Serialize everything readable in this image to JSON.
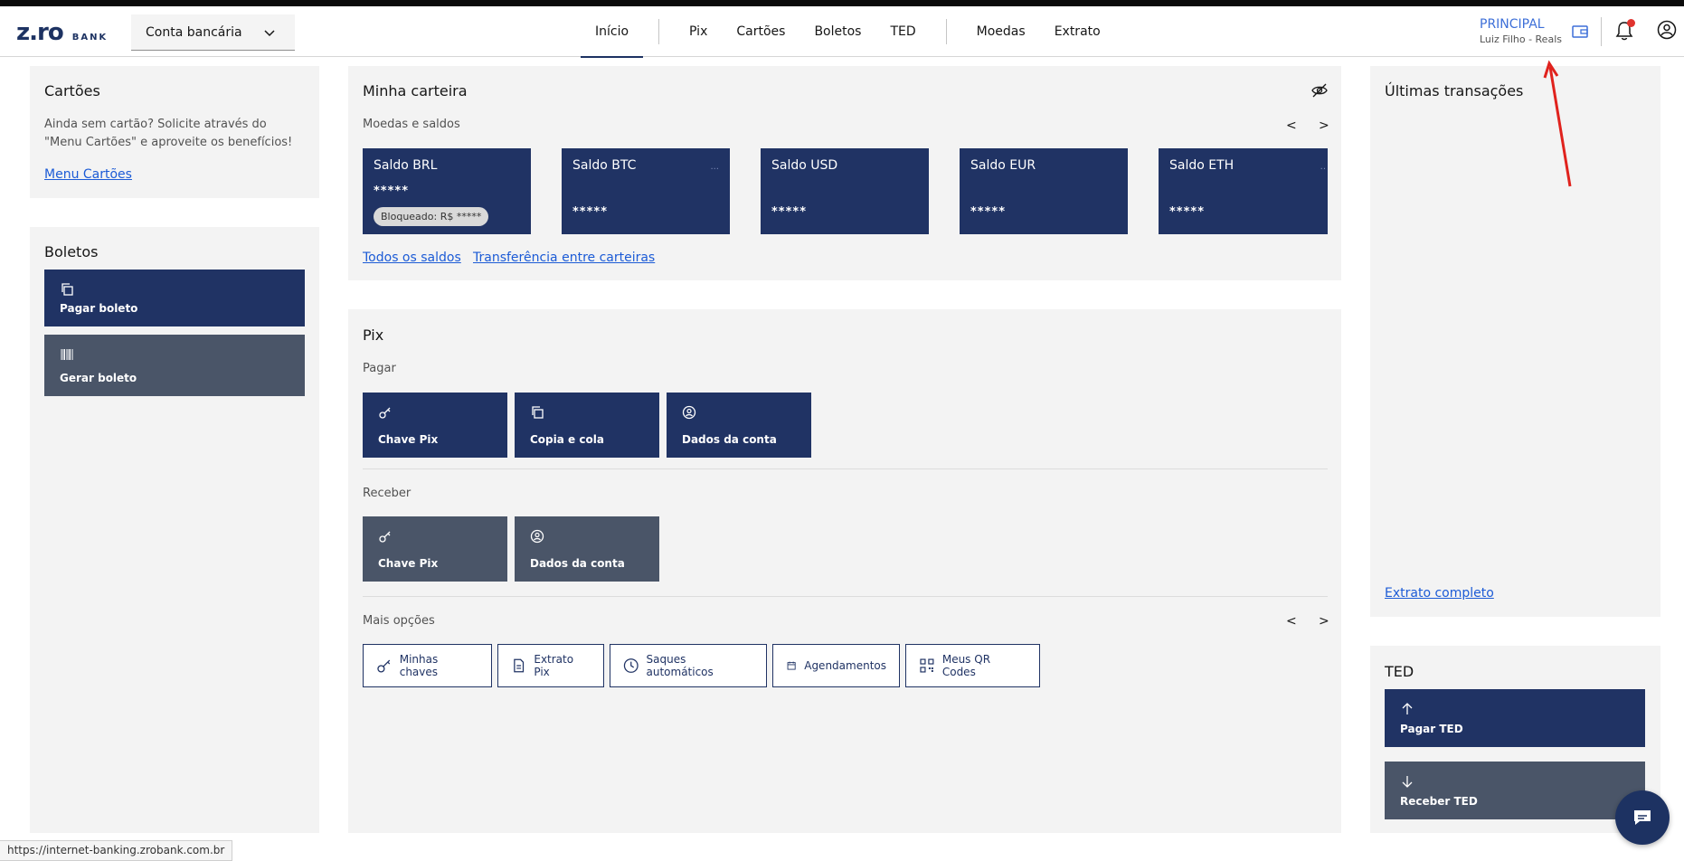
{
  "header": {
    "logo_main": "z.ro",
    "logo_bank": "BANK",
    "account_select": "Conta bancária",
    "nav": [
      "Início",
      "Pix",
      "Cartões",
      "Boletos",
      "TED",
      "Moedas",
      "Extrato"
    ],
    "principal": "PRINCIPAL",
    "principal_sub": "Luiz Filho - Reals"
  },
  "cards_panel": {
    "title": "Cartões",
    "text": "Ainda sem cartão? Solicite através do \"Menu Cartões\" e aproveite os benefícios!",
    "link": "Menu Cartões"
  },
  "boletos_panel": {
    "title": "Boletos",
    "pay": "Pagar boleto",
    "generate": "Gerar boleto"
  },
  "wallet": {
    "title": "Minha carteira",
    "subtitle": "Moedas e saldos",
    "prev": "<",
    "next": ">",
    "balances": [
      {
        "name": "Saldo BRL",
        "value": "*****",
        "blocked": "Bloqueado: R$ *****"
      },
      {
        "name": "Saldo BTC",
        "value": "*****"
      },
      {
        "name": "Saldo USD",
        "value": "*****"
      },
      {
        "name": "Saldo EUR",
        "value": "*****"
      },
      {
        "name": "Saldo ETH",
        "value": "*****"
      }
    ],
    "link_all": "Todos os saldos",
    "link_transfer": "Transferência entre carteiras"
  },
  "pix": {
    "title": "Pix",
    "pay_title": "Pagar",
    "pay_items": [
      "Chave Pix",
      "Copia e cola",
      "Dados da conta"
    ],
    "receive_title": "Receber",
    "receive_items": [
      "Chave Pix",
      "Dados da conta"
    ],
    "more_title": "Mais opções",
    "prev": "<",
    "next": ">",
    "options": [
      "Minhas chaves",
      "Extrato Pix",
      "Saques automáticos",
      "Agendamentos",
      "Meus QR Codes"
    ]
  },
  "transactions": {
    "title": "Últimas transações",
    "link": "Extrato completo"
  },
  "ted": {
    "title": "TED",
    "pay": "Pagar TED",
    "receive": "Receber TED"
  },
  "statusbar": {
    "url": "https://internet-banking.zrobank.com.br"
  },
  "colors": {
    "primary": "#203364",
    "secondary": "#4a5568",
    "link": "#1c5bd6",
    "accent_red": "#e0332e"
  }
}
